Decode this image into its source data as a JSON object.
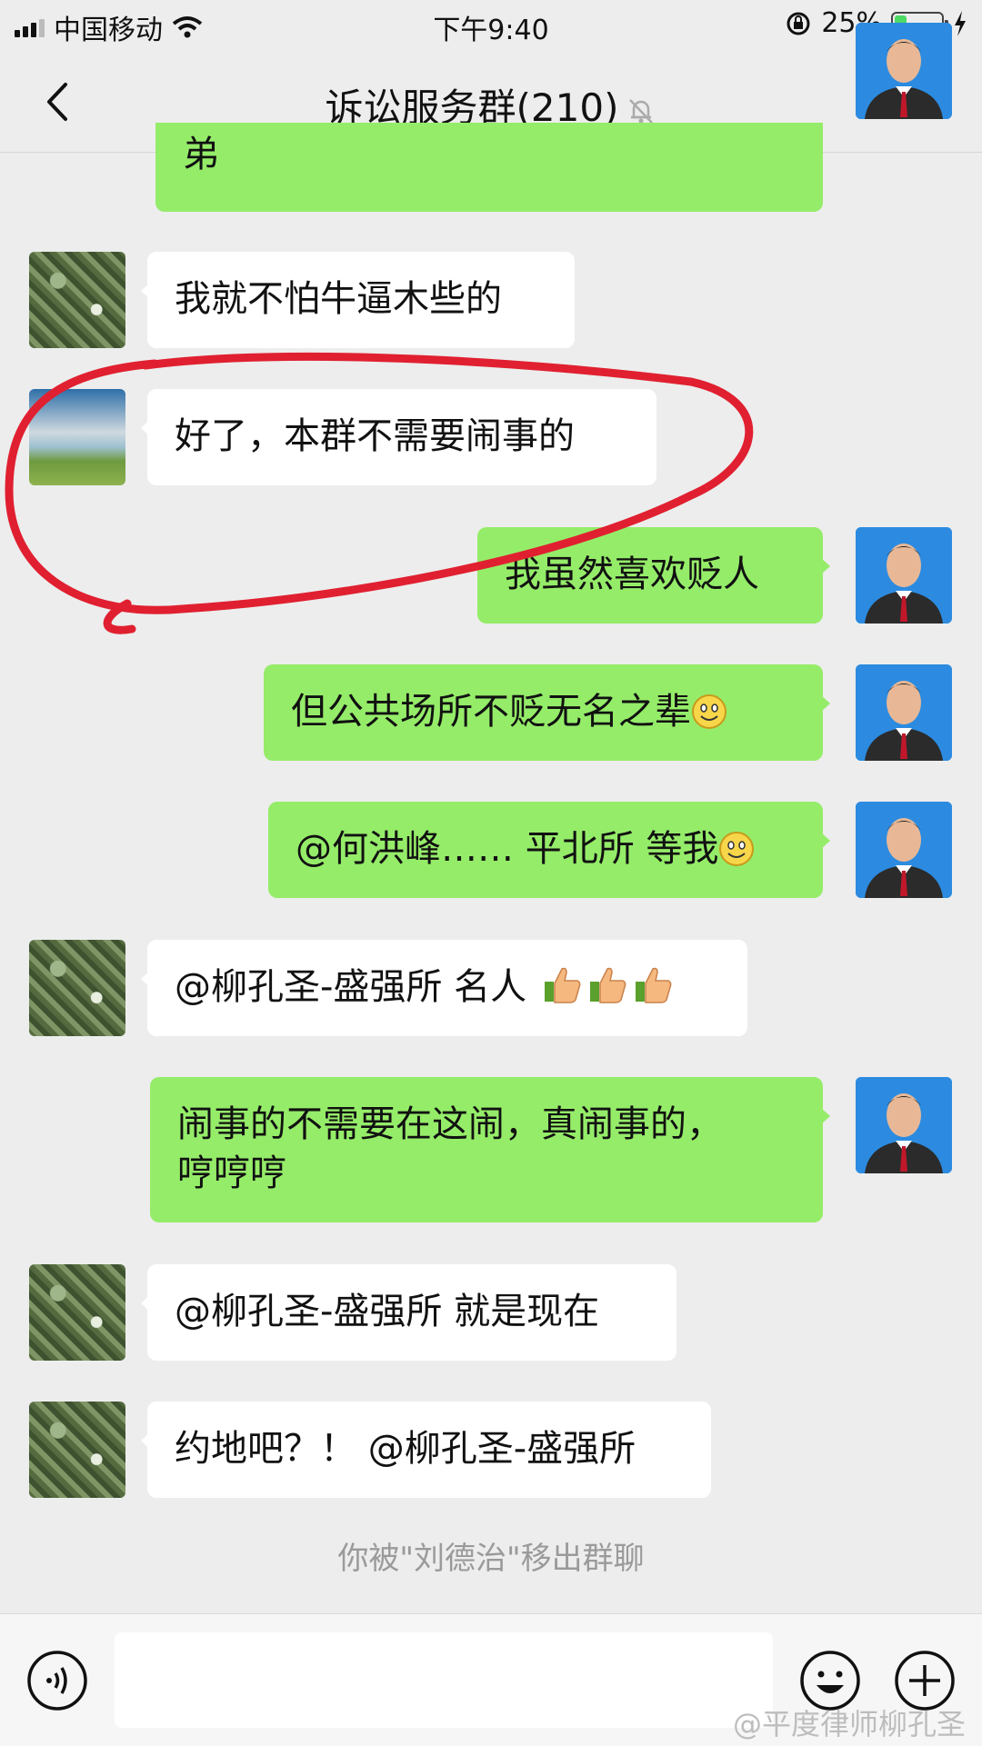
{
  "status_bar": {
    "carrier": "中国移动",
    "time": "下午9:40",
    "battery": "25%",
    "battery_level": 0.25
  },
  "header": {
    "title": "诉讼服务群(210)"
  },
  "messages": [
    {
      "side": "right",
      "text": "弟",
      "avatar": "man"
    },
    {
      "side": "left",
      "text": "我就不怕牛逼木些的",
      "avatar": "green"
    },
    {
      "side": "left",
      "text": "好了，本群不需要闹事的",
      "avatar": "lake"
    },
    {
      "side": "right",
      "text": "我虽然喜欢贬人",
      "avatar": "man"
    },
    {
      "side": "right",
      "text": "但公共场所不贬无名之辈",
      "avatar": "man",
      "emoji": "smile"
    },
    {
      "side": "right",
      "text": "@何洪峰…… 平北所 等我",
      "avatar": "man",
      "emoji": "smile"
    },
    {
      "side": "left",
      "text": "@柳孔圣-盛强所 名人",
      "avatar": "green",
      "emoji": "thumbs-up x3"
    },
    {
      "side": "right",
      "text": "闹事的不需要在这闹，真闹事的，\n哼哼哼",
      "avatar": "man"
    },
    {
      "side": "left",
      "text": "@柳孔圣-盛强所 就是现在",
      "avatar": "green"
    },
    {
      "side": "left",
      "text": "约地吧？！ @柳孔圣-盛强所",
      "avatar": "green"
    }
  ],
  "system_message": "你被\"刘德治\"移出群聊",
  "input_bar": {
    "voice_icon": "voice-icon",
    "emoji_icon": "emoji-icon",
    "plus_icon": "plus-icon"
  },
  "watermark": "@平度律师柳孔圣",
  "colors": {
    "my_bubble": "#95ec69",
    "annotation": "#e02030"
  }
}
